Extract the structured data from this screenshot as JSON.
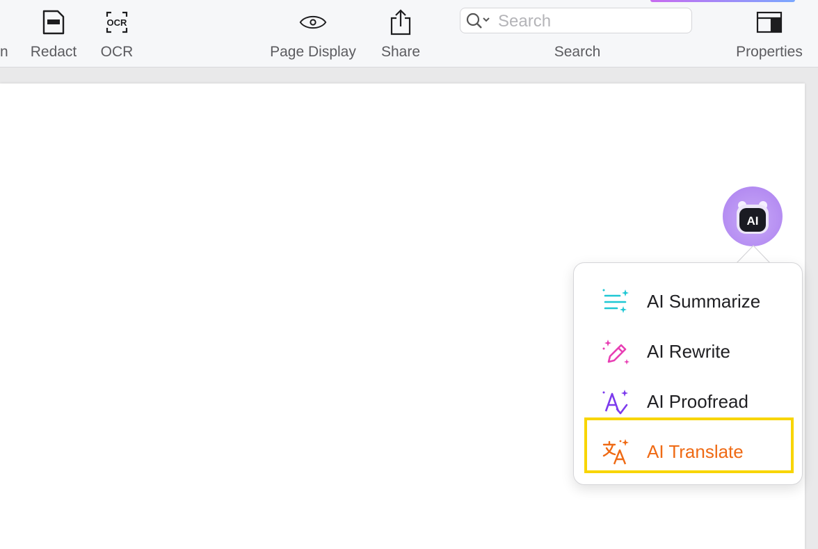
{
  "toolbar": {
    "truncated_label": "n",
    "redact_label": "Redact",
    "ocr_label": "OCR",
    "ocr_icon_text": "OCR",
    "page_display_label": "Page Display",
    "share_label": "Share",
    "search": {
      "placeholder": "Search",
      "label": "Search"
    },
    "properties_label": "Properties"
  },
  "ai": {
    "bubble_text": "AI",
    "menu": [
      {
        "label": "AI Summarize",
        "icon": "summarize-icon",
        "color": "#1fc7d4"
      },
      {
        "label": "AI Rewrite",
        "icon": "rewrite-icon",
        "color": "#e83fb4"
      },
      {
        "label": "AI Proofread",
        "icon": "proofread-icon",
        "color": "#7c3aed"
      },
      {
        "label": "AI Translate",
        "icon": "translate-icon",
        "color": "#ef6a14",
        "selected": true
      }
    ]
  },
  "colors": {
    "highlight": "#f8d500",
    "accent_purple": "#b48cf2"
  }
}
